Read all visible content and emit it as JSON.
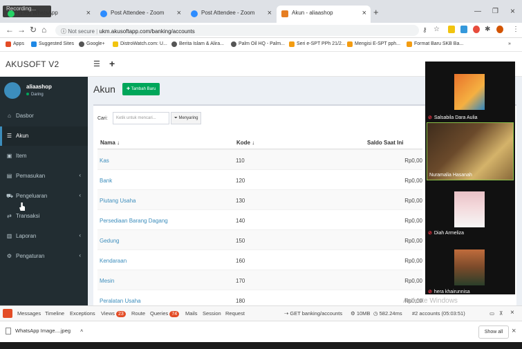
{
  "browser": {
    "recording": "Recording...",
    "tabs": [
      {
        "label": "(139) WhatsApp",
        "color": "#25d366"
      },
      {
        "label": "Post Attendee - Zoom",
        "color": "#2d8cff"
      },
      {
        "label": "Post Attendee - Zoom",
        "color": "#2d8cff"
      },
      {
        "label": "Akun - aliaashop",
        "color": "#e67e22"
      }
    ],
    "not_secure": "Not secure",
    "url": "ukm.akusoftapp.com/banking/accounts",
    "bookmarks": [
      {
        "label": "Apps",
        "color": "#e34c26"
      },
      {
        "label": "Suggested Sites",
        "color": "#1e88e5"
      },
      {
        "label": "Google+",
        "color": "#555"
      },
      {
        "label": "DistroWatch.com: U...",
        "color": "#f1c40f"
      },
      {
        "label": "Berita Islam & Alira...",
        "color": "#555"
      },
      {
        "label": "Palm Oil HQ - Palm...",
        "color": "#555"
      },
      {
        "label": "Seri e-SPT PPh 21/2...",
        "color": "#f39c12"
      },
      {
        "label": "Mengisi E-SPT pph...",
        "color": "#f39c12"
      },
      {
        "label": "Format Baru SKB Ba...",
        "color": "#f39c12"
      }
    ]
  },
  "app": {
    "brand": "AKUSOFT V2",
    "user": {
      "name": "aliaashop",
      "status": "Daring"
    },
    "menu": [
      {
        "label": "Dasbor",
        "icon": "dashboard-icon",
        "glyph": "⌂",
        "chevron": false
      },
      {
        "label": "Akun",
        "icon": "list-icon",
        "glyph": "☰",
        "chevron": false,
        "active": true
      },
      {
        "label": "Item",
        "icon": "cubes-icon",
        "glyph": "▣",
        "chevron": false
      },
      {
        "label": "Pemasukan",
        "icon": "money-icon",
        "glyph": "▤",
        "chevron": true
      },
      {
        "label": "Pengeluaran",
        "icon": "cart-icon",
        "glyph": "⛟",
        "chevron": true
      },
      {
        "label": "Transaksi",
        "icon": "exchange-icon",
        "glyph": "⇄",
        "chevron": false
      },
      {
        "label": "Laporan",
        "icon": "chart-icon",
        "glyph": "▥",
        "chevron": true
      },
      {
        "label": "Pengaturan",
        "icon": "gears-icon",
        "glyph": "⚙",
        "chevron": true
      }
    ],
    "page_title": "Akun",
    "add_button": "Tambah Baru",
    "search_label": "Cari:",
    "search_placeholder": "Ketik untuk mencari...",
    "filter_button": "Menyaring",
    "columns": {
      "name": "Nama",
      "code": "Kode",
      "saldo": "Saldo Saat Ini"
    },
    "rows": [
      {
        "name": "Kas",
        "code": "110",
        "saldo": "Rp0,00"
      },
      {
        "name": "Bank",
        "code": "120",
        "saldo": "Rp0,00"
      },
      {
        "name": "Piutang Usaha",
        "code": "130",
        "saldo": "Rp0,00"
      },
      {
        "name": "Persediaan Barang Dagang",
        "code": "140",
        "saldo": "Rp0,00"
      },
      {
        "name": "Gedung",
        "code": "150",
        "saldo": "Rp0,00"
      },
      {
        "name": "Kendaraan",
        "code": "160",
        "saldo": "Rp0,00"
      },
      {
        "name": "Mesin",
        "code": "170",
        "saldo": "Rp0,00"
      },
      {
        "name": "Peralatan Usaha",
        "code": "180",
        "saldo": "Rp0,00"
      }
    ]
  },
  "zoom": {
    "participants": [
      {
        "name": "Salsabila Dara Aulia",
        "muted": true
      },
      {
        "name": "Nuramalia Hasanah",
        "muted": false
      },
      {
        "name": "Diah Armeliza",
        "muted": true
      },
      {
        "name": "hera khairunnisa",
        "muted": true
      }
    ],
    "watermark": "Activate Windows"
  },
  "debugbar": {
    "items": [
      "Messages",
      "Timeline",
      "Exceptions",
      "Views",
      "Route",
      "Queries",
      "Mails",
      "Session",
      "Request"
    ],
    "views_count": "23",
    "queries_count": "74",
    "request": "GET banking/accounts",
    "memory": "10MB",
    "time": "582.24ms",
    "accounts": "#2 accounts (05:03:51)"
  },
  "downloads": {
    "file": "WhatsApp Image....jpeg",
    "show_all": "Show all"
  }
}
